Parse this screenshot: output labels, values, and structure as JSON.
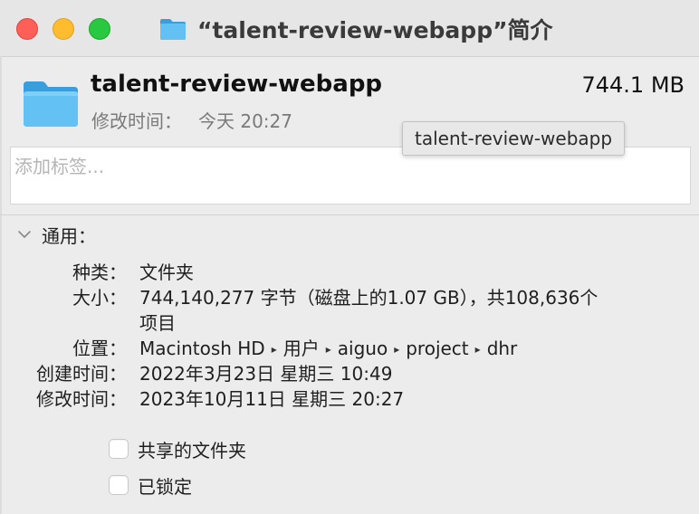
{
  "window": {
    "title": "“talent-review-webapp”简介"
  },
  "colors": {
    "close": "#fe5f57",
    "minimize": "#febc2e",
    "maximize": "#28c840",
    "folder": "#4fb6ee"
  },
  "header": {
    "name": "talent-review-webapp",
    "size": "744.1 MB",
    "modified_label": "修改时间：",
    "modified_value": "今天 20:27",
    "tooltip": "talent-review-webapp"
  },
  "tags": {
    "placeholder": "添加标签..."
  },
  "general": {
    "title": "通用：",
    "rows": [
      {
        "label": "种类：",
        "value": "文件夹"
      },
      {
        "label": "大小：",
        "value": "744,140,277 字节（磁盘上的1.07 GB），共108,636个",
        "value2": "项目"
      },
      {
        "label": "位置：",
        "crumbs": [
          "Macintosh HD",
          "用户",
          "aiguo",
          "project",
          "dhr"
        ],
        "separator": "▸"
      },
      {
        "label": "创建时间：",
        "value": "2022年3月23日 星期三 10:49"
      },
      {
        "label": "修改时间：",
        "value": "2023年10月11日 星期三 20:27"
      }
    ]
  },
  "options": {
    "shared_folder": "共享的文件夹",
    "locked": "已锁定"
  }
}
